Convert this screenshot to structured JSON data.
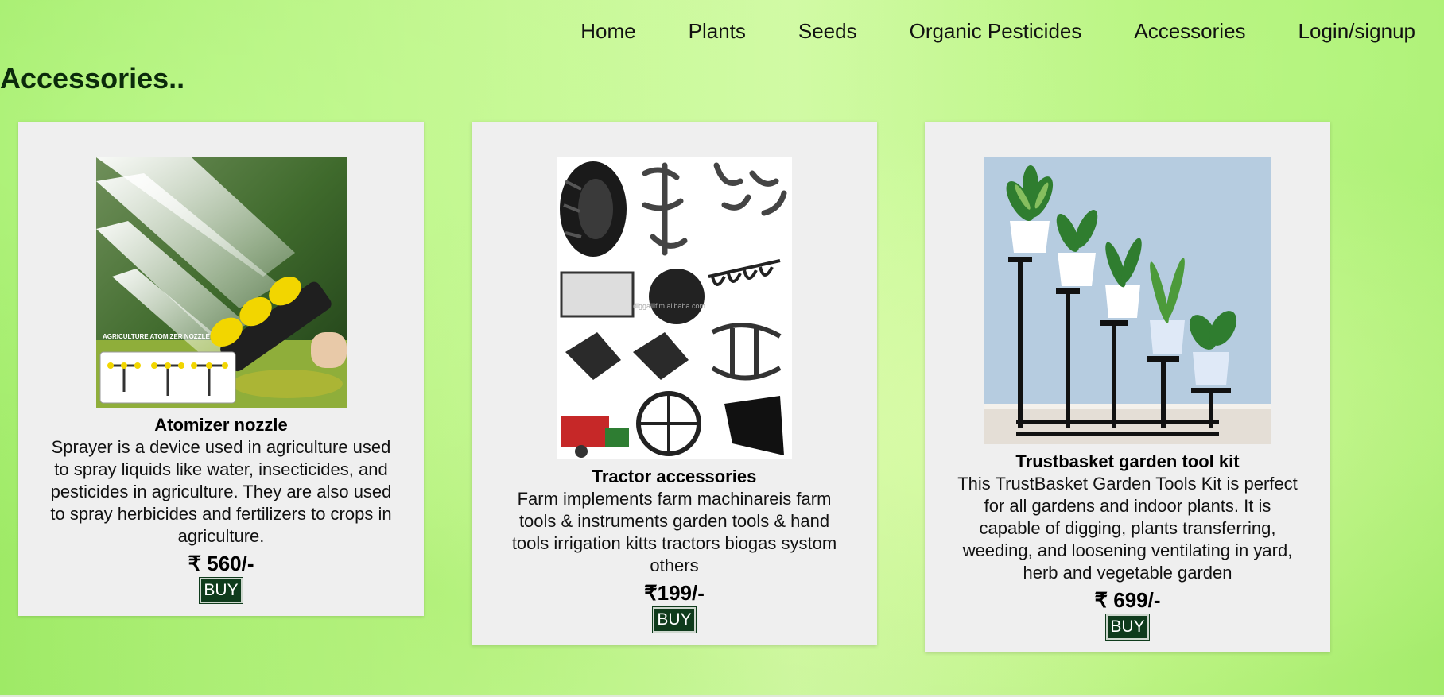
{
  "nav": {
    "items": [
      {
        "label": "Home"
      },
      {
        "label": "Plants"
      },
      {
        "label": "Seeds"
      },
      {
        "label": "Organic Pesticides"
      },
      {
        "label": "Accessories"
      },
      {
        "label": "Login/signup"
      }
    ]
  },
  "page": {
    "heading": "Accessories.."
  },
  "products": [
    {
      "title": "Atomizer nozzle",
      "description": "Sprayer is a device used in agriculture used to spray liquids like water, insecticides, and pesticides in agriculture. They are also used to spray herbicides and fertilizers to crops in agriculture.",
      "price": "₹ 560/-",
      "buy_label": "BUY",
      "image_caption": "AGRICULTURE ATOMIZER NOZZLE"
    },
    {
      "title": "Tractor accessories",
      "description": "Farm implements farm machinareis farm tools & instruments garden tools & hand tools irrigation kitts tractors biogas systom others",
      "price": "₹199/-",
      "buy_label": "BUY"
    },
    {
      "title": "Trustbasket garden tool kit",
      "description": "This TrustBasket Garden Tools Kit is perfect for all gardens and indoor plants. It is capable of digging, plants transferring, weeding, and loosening ventilating in yard, herb and vegetable garden",
      "price": "₹ 699/-",
      "buy_label": "BUY"
    }
  ]
}
